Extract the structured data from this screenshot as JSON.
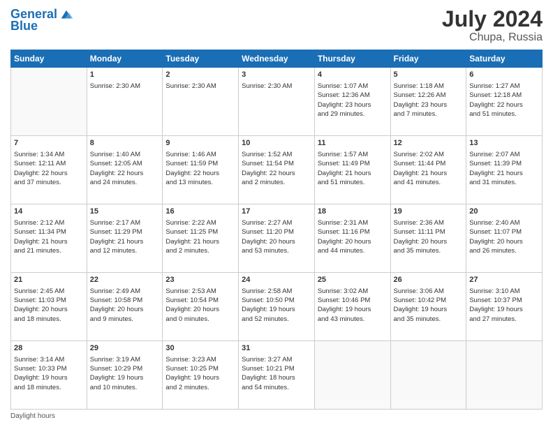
{
  "header": {
    "logo_line1": "General",
    "logo_line2": "Blue",
    "main_title": "July 2024",
    "subtitle": "Chupa, Russia"
  },
  "columns": [
    "Sunday",
    "Monday",
    "Tuesday",
    "Wednesday",
    "Thursday",
    "Friday",
    "Saturday"
  ],
  "weeks": [
    [
      {
        "day": "",
        "info": ""
      },
      {
        "day": "1",
        "info": "Sunrise: 2:30 AM"
      },
      {
        "day": "2",
        "info": "Sunrise: 2:30 AM"
      },
      {
        "day": "3",
        "info": "Sunrise: 2:30 AM"
      },
      {
        "day": "4",
        "info": "Sunrise: 1:07 AM\nSunset: 12:36 AM\nDaylight: 23 hours\nand 29 minutes."
      },
      {
        "day": "5",
        "info": "Sunrise: 1:18 AM\nSunset: 12:26 AM\nDaylight: 23 hours\nand 7 minutes."
      },
      {
        "day": "6",
        "info": "Sunrise: 1:27 AM\nSunset: 12:18 AM\nDaylight: 22 hours\nand 51 minutes."
      }
    ],
    [
      {
        "day": "7",
        "info": "Sunrise: 1:34 AM\nSunset: 12:11 AM\nDaylight: 22 hours\nand 37 minutes."
      },
      {
        "day": "8",
        "info": "Sunrise: 1:40 AM\nSunset: 12:05 AM\nDaylight: 22 hours\nand 24 minutes."
      },
      {
        "day": "9",
        "info": "Sunrise: 1:46 AM\nSunset: 11:59 PM\nDaylight: 22 hours\nand 13 minutes."
      },
      {
        "day": "10",
        "info": "Sunrise: 1:52 AM\nSunset: 11:54 PM\nDaylight: 22 hours\nand 2 minutes."
      },
      {
        "day": "11",
        "info": "Sunrise: 1:57 AM\nSunset: 11:49 PM\nDaylight: 21 hours\nand 51 minutes."
      },
      {
        "day": "12",
        "info": "Sunrise: 2:02 AM\nSunset: 11:44 PM\nDaylight: 21 hours\nand 41 minutes."
      },
      {
        "day": "13",
        "info": "Sunrise: 2:07 AM\nSunset: 11:39 PM\nDaylight: 21 hours\nand 31 minutes."
      }
    ],
    [
      {
        "day": "14",
        "info": "Sunrise: 2:12 AM\nSunset: 11:34 PM\nDaylight: 21 hours\nand 21 minutes."
      },
      {
        "day": "15",
        "info": "Sunrise: 2:17 AM\nSunset: 11:29 PM\nDaylight: 21 hours\nand 12 minutes."
      },
      {
        "day": "16",
        "info": "Sunrise: 2:22 AM\nSunset: 11:25 PM\nDaylight: 21 hours\nand 2 minutes."
      },
      {
        "day": "17",
        "info": "Sunrise: 2:27 AM\nSunset: 11:20 PM\nDaylight: 20 hours\nand 53 minutes."
      },
      {
        "day": "18",
        "info": "Sunrise: 2:31 AM\nSunset: 11:16 PM\nDaylight: 20 hours\nand 44 minutes."
      },
      {
        "day": "19",
        "info": "Sunrise: 2:36 AM\nSunset: 11:11 PM\nDaylight: 20 hours\nand 35 minutes."
      },
      {
        "day": "20",
        "info": "Sunrise: 2:40 AM\nSunset: 11:07 PM\nDaylight: 20 hours\nand 26 minutes."
      }
    ],
    [
      {
        "day": "21",
        "info": "Sunrise: 2:45 AM\nSunset: 11:03 PM\nDaylight: 20 hours\nand 18 minutes."
      },
      {
        "day": "22",
        "info": "Sunrise: 2:49 AM\nSunset: 10:58 PM\nDaylight: 20 hours\nand 9 minutes."
      },
      {
        "day": "23",
        "info": "Sunrise: 2:53 AM\nSunset: 10:54 PM\nDaylight: 20 hours\nand 0 minutes."
      },
      {
        "day": "24",
        "info": "Sunrise: 2:58 AM\nSunset: 10:50 PM\nDaylight: 19 hours\nand 52 minutes."
      },
      {
        "day": "25",
        "info": "Sunrise: 3:02 AM\nSunset: 10:46 PM\nDaylight: 19 hours\nand 43 minutes."
      },
      {
        "day": "26",
        "info": "Sunrise: 3:06 AM\nSunset: 10:42 PM\nDaylight: 19 hours\nand 35 minutes."
      },
      {
        "day": "27",
        "info": "Sunrise: 3:10 AM\nSunset: 10:37 PM\nDaylight: 19 hours\nand 27 minutes."
      }
    ],
    [
      {
        "day": "28",
        "info": "Sunrise: 3:14 AM\nSunset: 10:33 PM\nDaylight: 19 hours\nand 18 minutes."
      },
      {
        "day": "29",
        "info": "Sunrise: 3:19 AM\nSunset: 10:29 PM\nDaylight: 19 hours\nand 10 minutes."
      },
      {
        "day": "30",
        "info": "Sunrise: 3:23 AM\nSunset: 10:25 PM\nDaylight: 19 hours\nand 2 minutes."
      },
      {
        "day": "31",
        "info": "Sunrise: 3:27 AM\nSunset: 10:21 PM\nDaylight: 18 hours\nand 54 minutes."
      },
      {
        "day": "",
        "info": ""
      },
      {
        "day": "",
        "info": ""
      },
      {
        "day": "",
        "info": ""
      }
    ]
  ],
  "footer": {
    "note": "Daylight hours"
  }
}
